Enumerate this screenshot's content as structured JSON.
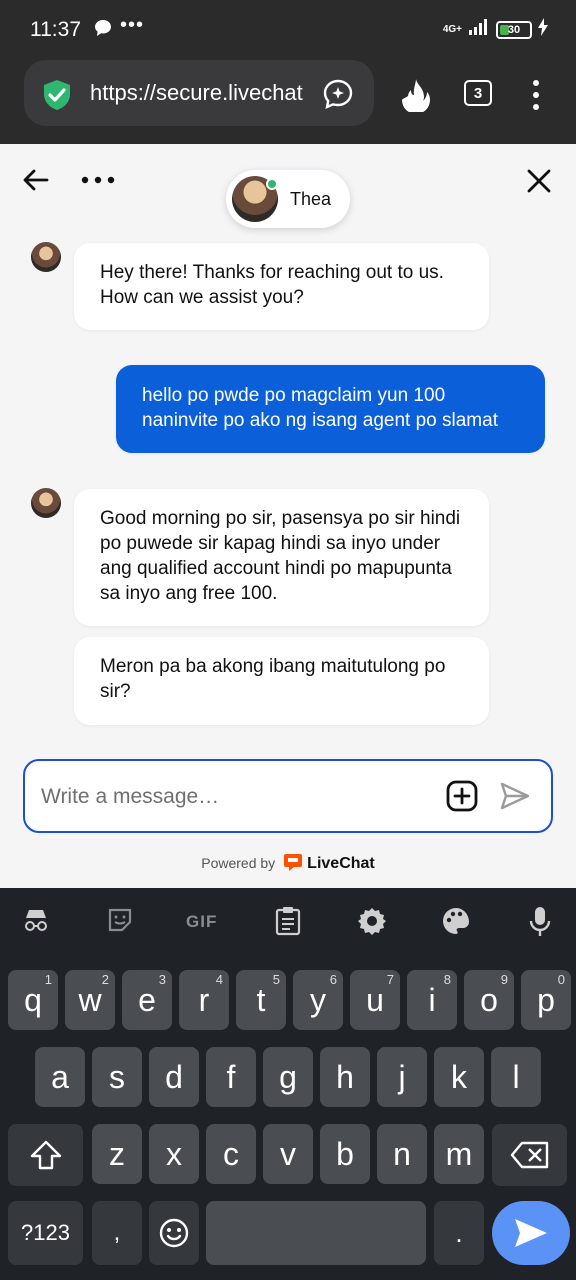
{
  "status_bar": {
    "time": "11:37",
    "net": "4G+",
    "battery": "30",
    "battery_level": 0.3
  },
  "browser": {
    "url": "https://secure.livechat",
    "tab_count": "3"
  },
  "chat": {
    "agent_name": "Thea",
    "messages": [
      {
        "from": "agent",
        "lines": [
          "Hey there! Thanks for reaching out to us.",
          "How can we assist you?"
        ]
      },
      {
        "from": "user",
        "lines": [
          "hello po pwde po magclaim yun 100",
          "naninvite po ako ng isang agent po slamat"
        ]
      },
      {
        "from": "agent",
        "lines": [
          "Good morning po sir, pasensya po sir hindi",
          "po puwede sir kapag hindi sa inyo under",
          "ang qualified account hindi po mapupunta",
          "sa inyo ang free 100."
        ]
      },
      {
        "from": "agent",
        "lines": [
          "Meron pa ba akong ibang maitutulong po",
          "sir?"
        ]
      }
    ],
    "composer_placeholder": "Write a message…",
    "powered_by": "Powered by",
    "brand": "LiveChat"
  },
  "keyboard": {
    "row1": [
      {
        "k": "q",
        "n": "1"
      },
      {
        "k": "w",
        "n": "2"
      },
      {
        "k": "e",
        "n": "3"
      },
      {
        "k": "r",
        "n": "4"
      },
      {
        "k": "t",
        "n": "5"
      },
      {
        "k": "y",
        "n": "6"
      },
      {
        "k": "u",
        "n": "7"
      },
      {
        "k": "i",
        "n": "8"
      },
      {
        "k": "o",
        "n": "9"
      },
      {
        "k": "p",
        "n": "0"
      }
    ],
    "row2": [
      "a",
      "s",
      "d",
      "f",
      "g",
      "h",
      "j",
      "k",
      "l"
    ],
    "row3": [
      "z",
      "x",
      "c",
      "v",
      "b",
      "n",
      "m"
    ],
    "symbols_label": "?123",
    "comma": ",",
    "period": ".",
    "gif_label": "GIF"
  },
  "colors": {
    "accent": "#0b5fd9",
    "online": "#2fb66f",
    "livechat_orange": "#ff5100"
  }
}
